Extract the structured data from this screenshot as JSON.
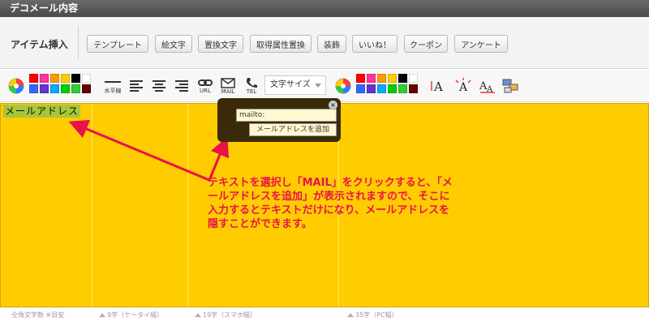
{
  "window": {
    "title": "デコメール内容"
  },
  "item_insert": {
    "label": "アイテム挿入",
    "buttons": [
      "テンプレート",
      "絵文字",
      "置換文字",
      "取得属性置換",
      "装飾",
      "いいね！",
      "クーポン",
      "アンケート"
    ]
  },
  "toolbar": {
    "hr_label": "水平線",
    "url_label": "URL",
    "mail_label": "MAIL",
    "tel_label": "TEL",
    "font_size_label": "文字サイズ",
    "palette_colors": [
      "#ff0000",
      "#ff3399",
      "#ff9900",
      "#ffcc00",
      "#000000",
      "#ffffff",
      "#3366ff",
      "#6633cc",
      "#00aaff",
      "#00cc00",
      "#33cc33",
      "#660000"
    ],
    "icons": [
      "text-color-icon",
      "hr-icon",
      "align-left-icon",
      "align-center-icon",
      "align-right-icon",
      "link-icon",
      "mail-icon",
      "phone-icon",
      "bg-color-icon",
      "text-large-icon",
      "text-sparkle-icon",
      "text-size-icon",
      "image-icon"
    ]
  },
  "editor": {
    "selected_text": "メールアドレス",
    "background": "#ffcc00"
  },
  "mail_popup": {
    "input_value": "mailto:",
    "add_button": "メールアドレスを追加"
  },
  "annotation": {
    "text": "テキストを選択し「MAIL」をクリックすると、「メールアドレスを追加」が表示されますので、そこに入力するとテキストだけになり、メールアドレスを隠すことができます。",
    "color": "#e8124a"
  },
  "footer": {
    "char_count": "全角文字数 ※目安",
    "guide_keitai": "9字（ケータイ幅）",
    "guide_smapho": "19字（スマホ幅）",
    "guide_pc": "35字（PC幅）"
  }
}
